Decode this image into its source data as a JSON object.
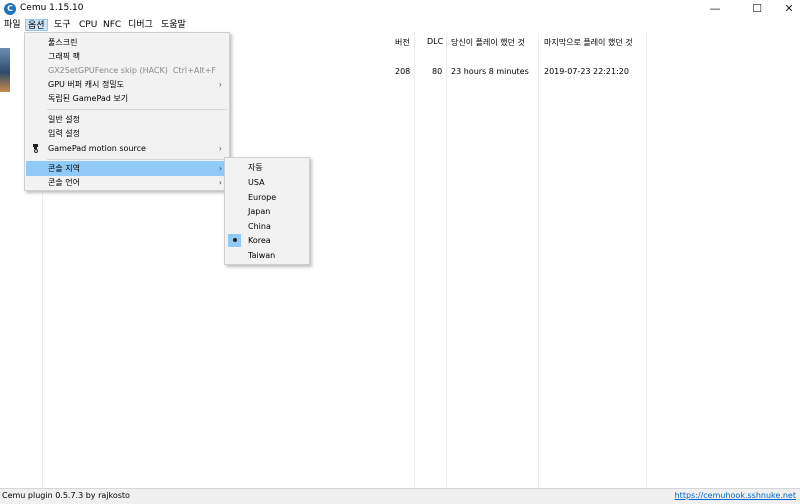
{
  "window": {
    "title": "Cemu 1.15.10",
    "app_icon": "C"
  },
  "window_controls": {
    "minimize": "—",
    "maximize": "☐",
    "close": "✕"
  },
  "menubar": [
    "파일",
    "옵션",
    "도구",
    "CPU",
    "NFC",
    "디버그",
    "도움말"
  ],
  "columns": [
    "버전",
    "DLC",
    "당신이 플레이 했던 것",
    "마지막으로 플레이 했던 것"
  ],
  "row": {
    "version": "208",
    "dlc": "80",
    "played": "23 hours 8 minutes",
    "last_played": "2019-07-23 22:21:20"
  },
  "options_menu": {
    "items": [
      {
        "label": "풀스크린"
      },
      {
        "label": "그래픽 팩"
      },
      {
        "label": "GX2SetGPUFence skip (HACK)",
        "shortcut": "Ctrl+Alt+F",
        "disabled": true
      },
      {
        "label": "GPU 버퍼 캐시 정밀도"
      },
      {
        "label": "독립된 GamePad 보기"
      },
      {
        "label": "일반 설정"
      },
      {
        "label": "입력 설정"
      },
      {
        "label": "GamePad motion source"
      },
      {
        "label": "콘솔 지역"
      },
      {
        "label": "콘솔 언어"
      }
    ]
  },
  "region_menu": {
    "items": [
      "자동",
      "USA",
      "Europe",
      "Japan",
      "China",
      "Korea",
      "Taiwan"
    ],
    "selected": "Korea"
  },
  "status": {
    "left": "Cemu plugin 0.5.7.3 by rajkosto",
    "right": "https://cemuhook.sshnuke.net"
  },
  "colors": {
    "highlight": "#91c9f7",
    "menu_bg": "#f2f2f2",
    "link": "#0066cc"
  }
}
